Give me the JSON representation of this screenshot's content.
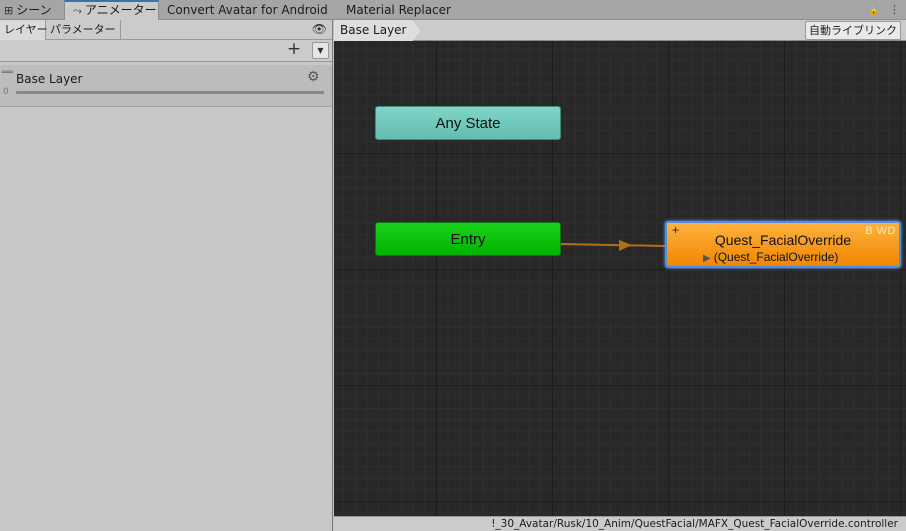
{
  "tabs": [
    {
      "label": "シーン",
      "icon": "grid-icon"
    },
    {
      "label": "アニメーター",
      "icon": "animator-icon",
      "active": true
    },
    {
      "label": "Convert Avatar for Android"
    },
    {
      "label": "Material Replacer"
    }
  ],
  "window_controls": {
    "lock_icon": "🔒",
    "menu_icon": "⋮"
  },
  "left_panel": {
    "subtabs": [
      "レイヤー",
      "パラメーター"
    ],
    "eye_icon": "👁",
    "add_label": "+",
    "dropdown_label": "▼",
    "layers": [
      {
        "name": "Base Layer",
        "weight_label": "0",
        "weight": 1.0
      }
    ]
  },
  "graph": {
    "breadcrumb": "Base Layer",
    "auto_live_link": "自動ライブリンク",
    "nodes": {
      "any_state": "Any State",
      "entry": "Entry",
      "state": {
        "plus": "+",
        "flags": "B WD",
        "name": "Quest_FacialOverride",
        "motion": "(Quest_FacialOverride)"
      }
    },
    "colors": {
      "any_state": "#6ec9bc",
      "entry": "#0fc20f",
      "state": "#f7a024",
      "transition": "#b36d1a",
      "selection": "#4a8fe0"
    }
  },
  "status": {
    "path": "!_30_Avatar/Rusk/10_Anim/QuestFacial/MAFX_Quest_FacialOverride.controller"
  }
}
